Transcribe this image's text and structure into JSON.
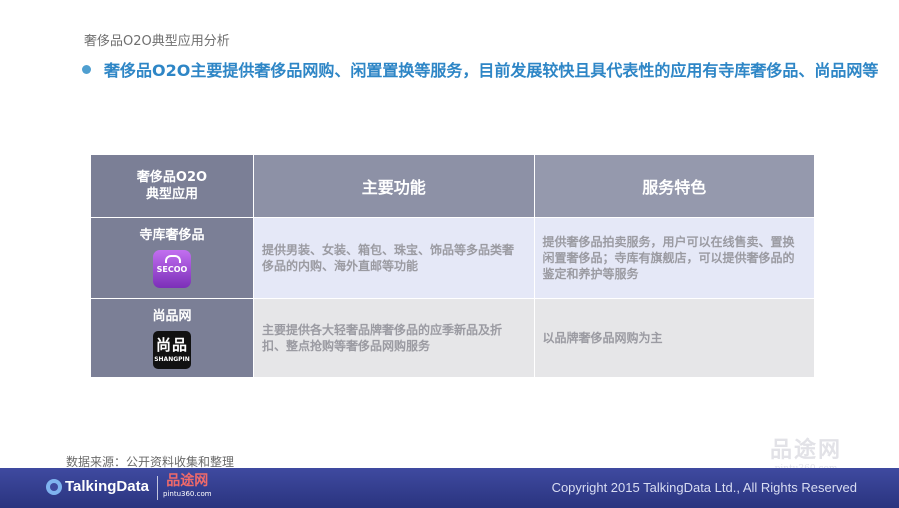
{
  "page_title": "奢侈品O2O典型应用分析",
  "bullet": "奢侈品O2O主要提供奢侈品网购、闲置置换等服务，目前发展较快且具代表性的应用有寺库奢侈品、尚品网等",
  "table": {
    "header_left_line1": "奢侈品O2O",
    "header_left_line2": "典型应用",
    "header_mid": "主要功能",
    "header_right": "服务特色",
    "rows": [
      {
        "name": "寺库奢侈品",
        "logo_text": "SECOO",
        "function": "提供男装、女装、箱包、珠宝、饰品等多品类奢侈品的内购、海外直邮等功能",
        "feature": "提供奢侈品拍卖服务，用户可以在线售卖、置换闲置奢侈品；寺库有旗舰店，可以提供奢侈品的鉴定和养护等服务"
      },
      {
        "name": "尚品网",
        "logo_text_big": "尚品",
        "logo_text_small": "SHANGPIN",
        "function": "主要提供各大轻奢品牌奢侈品的应季新品及折扣、整点抢购等奢侈品网购服务",
        "feature": "以品牌奢侈品网购为主"
      }
    ]
  },
  "source": "数据来源：公开资料收集和整理",
  "footer": {
    "brand": "TalkingData",
    "partner_name": "品途网",
    "partner_url": "pintu360.com",
    "copyright": "Copyright 2015 TalkingData Ltd., All Rights Reserved"
  },
  "watermark": {
    "name": "品途网",
    "url": "pintu360.com"
  },
  "colors": {
    "accent_blue": "#2e86c6",
    "header_gray": "#7b7f96",
    "footer_navy": "#2a347f"
  }
}
